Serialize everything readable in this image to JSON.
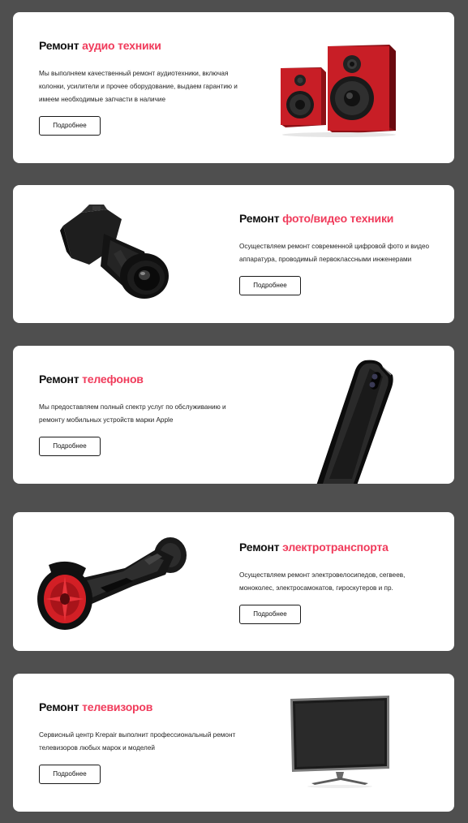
{
  "services": [
    {
      "id": "audio",
      "title_prefix": "Ремонт",
      "title_accent": "аудио техники",
      "description": "Мы выполняем качественный ремонт аудиотехники, включая колонки, усилители и прочее оборудование, выдаем гарантию и имеем необходимые запчасти в наличие",
      "button_label": "Подробнее",
      "image_icon": "speakers-image"
    },
    {
      "id": "photo",
      "title_prefix": "Ремонт",
      "title_accent": "фото/видео техники",
      "description": "Осуществляем ремонт современной цифровой фото и видео аппаратура, проводимый первоклассными инженерами",
      "button_label": "Подробнее",
      "image_icon": "camera-image"
    },
    {
      "id": "phone",
      "title_prefix": "Ремонт",
      "title_accent": "телефонов",
      "description": "Мы предоставляем полный спектр услуг по обслуживанию и ремонту мобильных устройств марки Apple",
      "button_label": "Подробнее",
      "image_icon": "iphone-image"
    },
    {
      "id": "ev",
      "title_prefix": "Ремонт",
      "title_accent": "электротранспорта",
      "description": "Осуществляем ремонт электровелосипедов, сегвеев, моноколес, электросамокатов, гироскутеров и пр.",
      "button_label": "Подробнее",
      "image_icon": "hoverboard-image"
    },
    {
      "id": "tv",
      "title_prefix": "Ремонт",
      "title_accent": "телевизоров",
      "description": "Сервисный центр Krepair выполнит профессиональный ремонт телевизоров любых марок и моделей",
      "button_label": "Подробнее",
      "image_icon": "tv-image"
    }
  ],
  "colors": {
    "page_background": "#4f4f4f",
    "card_background": "#ffffff",
    "accent": "#f03b5b",
    "text": "#111111"
  }
}
